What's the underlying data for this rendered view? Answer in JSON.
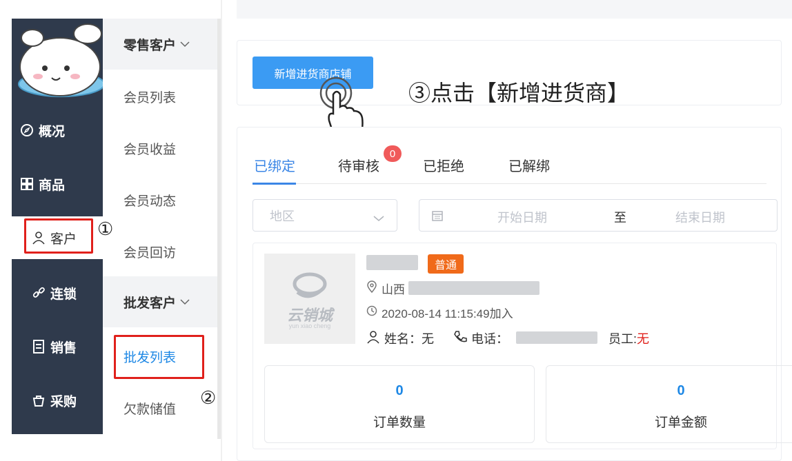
{
  "nav": {
    "items": [
      {
        "label": "概况",
        "icon": "compass-icon"
      },
      {
        "label": "商品",
        "icon": "grid-icon"
      },
      {
        "label": "客户",
        "icon": "user-icon"
      },
      {
        "label": "连锁",
        "icon": "link-icon"
      },
      {
        "label": "销售",
        "icon": "receipt-icon"
      },
      {
        "label": "采购",
        "icon": "bag-icon"
      }
    ],
    "active_index": 2
  },
  "submenu": {
    "retail": {
      "title": "零售客户",
      "items": [
        "会员列表",
        "会员收益",
        "会员动态",
        "会员回访"
      ]
    },
    "wholesale": {
      "title": "批发客户",
      "items": [
        "批发列表",
        "欠款储值"
      ]
    }
  },
  "toolbar": {
    "add_button": "新增进货商店铺"
  },
  "annotations": {
    "step1": "①",
    "step2": "②",
    "step3": "③点击【新增进货商】"
  },
  "tabs": [
    {
      "label": "已绑定",
      "active": true
    },
    {
      "label": "待审核",
      "badge": "0"
    },
    {
      "label": "已拒绝"
    },
    {
      "label": "已解绑"
    }
  ],
  "filters": {
    "region_placeholder": "地区",
    "start_placeholder": "开始日期",
    "range_sep": "至",
    "end_placeholder": "结束日期"
  },
  "shop": {
    "tag": "普通",
    "address_prefix": "山西",
    "joined": "2020-08-14 11:15:49加入",
    "name_label": "姓名：无",
    "phone_label": "电话：",
    "staff_label": "员工:",
    "staff_value": "无",
    "logo_text": "云销城",
    "logo_subtext": "yun xiao cheng"
  },
  "stats": [
    {
      "value": "0",
      "label": "订单数量"
    },
    {
      "value": "0",
      "label": "订单金额"
    }
  ],
  "colors": {
    "nav_bg": "#2f3a4c",
    "primary": "#3b9bf3",
    "highlight": "#e0201b",
    "tag": "#f06a1a"
  }
}
